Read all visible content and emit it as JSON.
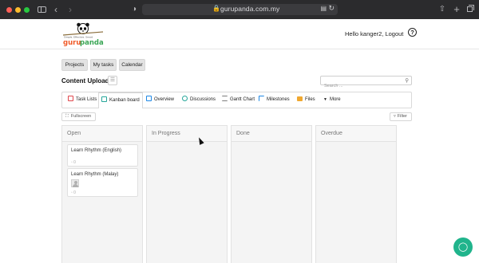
{
  "browser": {
    "url": "gurupanda.com.my"
  },
  "header": {
    "logo_text": "gurupanda",
    "logo_tagline": "Simple. Effective. Smart",
    "greeting": "Hello kanger2, Logout",
    "help_symbol": "?"
  },
  "nav": {
    "projects": "Projects",
    "my_tasks": "My tasks",
    "calendar": "Calendar"
  },
  "page": {
    "title": "Content Upload",
    "search_placeholder": "Search ..."
  },
  "tabs": [
    {
      "label": "Task Lists",
      "icon": "task-lists-icon",
      "color": "#e0464c"
    },
    {
      "label": "Kanban board",
      "icon": "kanban-icon",
      "color": "#26a69a",
      "active": true
    },
    {
      "label": "Overview",
      "icon": "overview-icon",
      "color": "#1e88e5"
    },
    {
      "label": "Discussions",
      "icon": "discussions-icon",
      "color": "#26a69a"
    },
    {
      "label": "Gantt Chart",
      "icon": "gantt-icon",
      "color": "#7d7d7d"
    },
    {
      "label": "Milestones",
      "icon": "milestones-icon",
      "color": "#1e88e5"
    },
    {
      "label": "Files",
      "icon": "folder-icon",
      "color": "#f0a830"
    },
    {
      "label": "More",
      "icon": "chevron-down-icon",
      "color": "#555555"
    }
  ],
  "toolbar": {
    "fullscreen": "Fullscreen",
    "filter": "Filter"
  },
  "columns": [
    {
      "name": "Open",
      "cards": [
        {
          "title": "Learn Rhythm (English)",
          "meta": "0"
        },
        {
          "title": "Learn Rhythm (Malay)",
          "meta": "0"
        }
      ]
    },
    {
      "name": "In Progress",
      "cards": []
    },
    {
      "name": "Done",
      "cards": []
    },
    {
      "name": "Overdue",
      "cards": []
    }
  ],
  "colors": {
    "brand_green": "#20b48c",
    "logo_orange": "#f05a28",
    "logo_green": "#3aa655"
  }
}
